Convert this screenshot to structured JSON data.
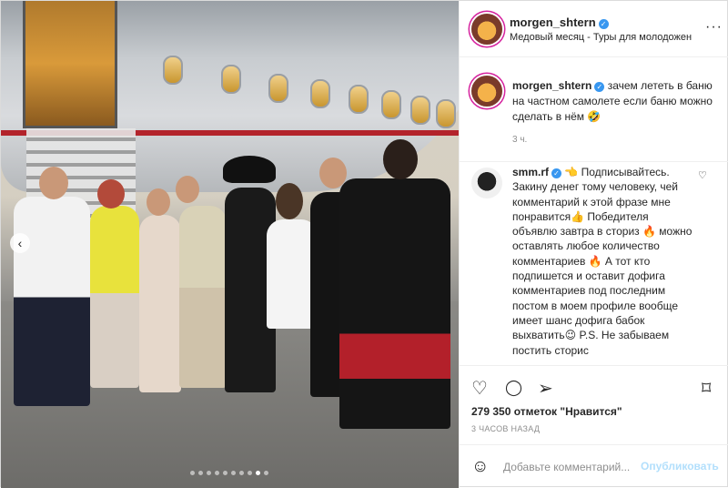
{
  "post": {
    "nav_prev_icon": "chevron-left-icon",
    "carousel": {
      "count": 10,
      "active_index": 8
    }
  },
  "header": {
    "username": "morgen_shtern",
    "verified_glyph": "✓",
    "subtitle": "Медовый месяц - Туры для молодожен",
    "more_icon": "···"
  },
  "caption": {
    "username": "morgen_shtern",
    "text": "зачем лететь в баню на частном самолете если баню можно сделать в нём 🤣",
    "time": "3 ч."
  },
  "comment": {
    "username": "smm.rf",
    "text": "👈 Подписывайтесь. Закину денег тому человеку, чей комментарий к этой фразе мне понравится👍 Победителя объявлю завтра в сториз 🔥 можно оставлять любое количество комментариев 🔥 А тот кто подпишется и оставит дофига комментариев под последним постом в моем профиле вообще имеет шанс дофига бабок выхватить😉 P.S. Не забываем постить сторис",
    "like_icon": "♡"
  },
  "actions": {
    "like_icon": "♡",
    "comment_icon": "◯",
    "share_icon": "➢",
    "save_icon": "⌑",
    "likes": "279 350 отметок \"Нравится\"",
    "time_ago": "3 ЧАСОВ НАЗАД"
  },
  "composer": {
    "emoji_icon": "☺",
    "placeholder": "Добавьте комментарий...",
    "post_label": "Опубликовать"
  },
  "colors": {
    "accent": "#3897f0",
    "post_button_disabled": "#b2dffc",
    "muted": "#8e8e8e"
  }
}
